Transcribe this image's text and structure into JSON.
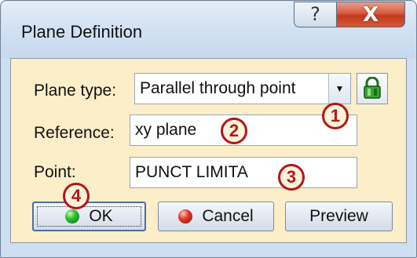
{
  "window": {
    "title": "Plane Definition",
    "help_glyph": "?",
    "close_glyph": "X"
  },
  "form": {
    "plane_type_label": "Plane type:",
    "plane_type_value": "Parallel through point",
    "combo_arrow": "▼",
    "reference_label": "Reference:",
    "reference_value": "xy plane",
    "point_label": "Point:",
    "point_value": "PUNCT LIMITA"
  },
  "buttons": {
    "ok": "OK",
    "cancel": "Cancel",
    "preview": "Preview"
  },
  "markers": [
    "1",
    "2",
    "3",
    "4"
  ],
  "colors": {
    "dialog_background": "#fbeec8",
    "marker": "#b01818",
    "close_button": "#c2391c"
  },
  "icons": {
    "lock_button": "green-lock-icon",
    "ok": "green-dot-icon",
    "cancel": "red-dot-icon"
  }
}
